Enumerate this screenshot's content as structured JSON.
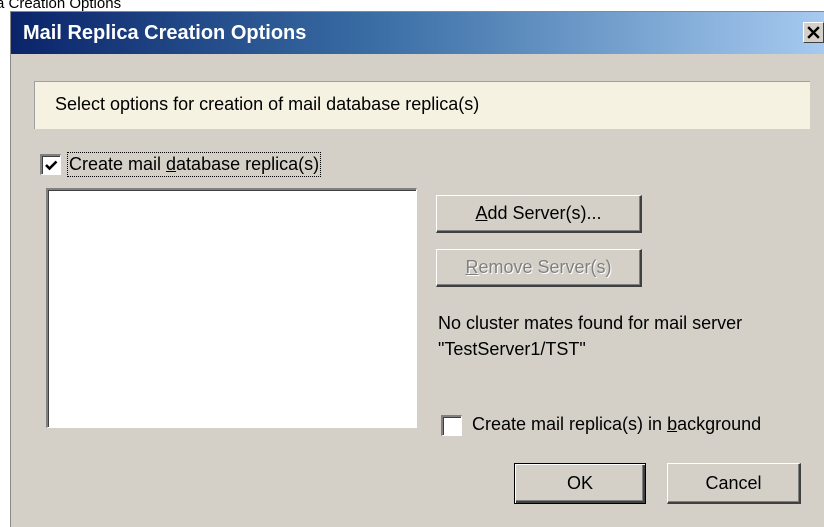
{
  "outer_caption": "a Creation Options",
  "window": {
    "title": "Mail Replica Creation Options",
    "close_glyph": "✕"
  },
  "info": {
    "text": "Select options for creation of mail database replica(s)"
  },
  "create_replica": {
    "checked": true,
    "label_pre": "Create mail ",
    "label_accel": "d",
    "label_post": "atabase replica(s)"
  },
  "server_list": {
    "items": []
  },
  "buttons": {
    "add_accel": "A",
    "add_rest": "dd Server(s)...",
    "remove_accel": "R",
    "remove_rest": "emove Server(s)",
    "ok": "OK",
    "cancel": "Cancel"
  },
  "status": {
    "line1": "No cluster mates found for mail server",
    "line2": "\"TestServer1/TST\""
  },
  "background_option": {
    "checked": false,
    "label_pre": "Create mail replica(s) in ",
    "label_accel": "b",
    "label_post": "ackground"
  },
  "colors": {
    "titlebar_start": "#0a246a",
    "titlebar_end": "#a6caf0",
    "dialog_bg": "#d4d0c8",
    "info_bg": "#f5f2e2"
  }
}
